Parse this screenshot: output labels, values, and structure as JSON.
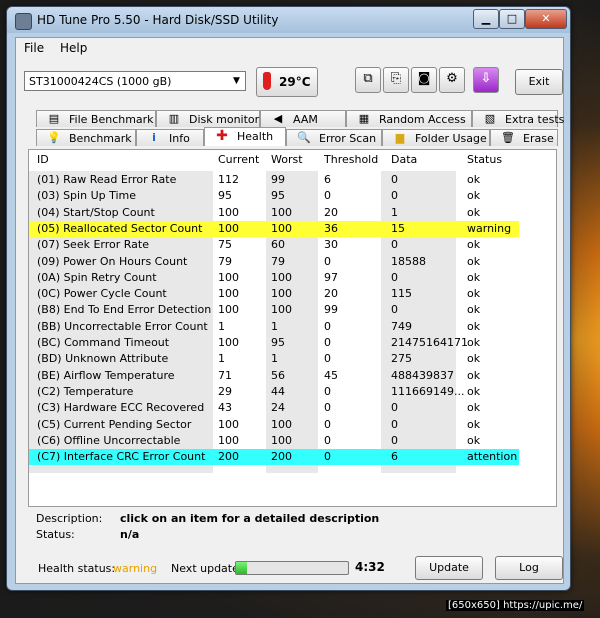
{
  "window": {
    "title": "HD Tune Pro 5.50 - Hard Disk/SSD Utility"
  },
  "window_buttons": {
    "minimize": "▁",
    "maximize": "□",
    "close": "✕"
  },
  "menu": [
    "File",
    "Help"
  ],
  "toolbar": {
    "drive": "ST31000424CS (1000 gB)",
    "temperature": "29°C",
    "exit_label": "Exit"
  },
  "tabs_top": [
    {
      "label": "File Benchmark",
      "icon": "file-benchmark-icon"
    },
    {
      "label": "Disk monitor",
      "icon": "disk-monitor-icon"
    },
    {
      "label": "AAM",
      "icon": "speaker-icon"
    },
    {
      "label": "Random Access",
      "icon": "random-access-icon"
    },
    {
      "label": "Extra tests",
      "icon": "extra-tests-icon"
    }
  ],
  "tabs_bottom": [
    {
      "label": "Benchmark",
      "icon": "benchmark-icon"
    },
    {
      "label": "Info",
      "icon": "info-icon"
    },
    {
      "label": "Health",
      "icon": "health-icon"
    },
    {
      "label": "Error Scan",
      "icon": "error-scan-icon"
    },
    {
      "label": "Folder Usage",
      "icon": "folder-icon"
    },
    {
      "label": "Erase",
      "icon": "erase-icon"
    }
  ],
  "table": {
    "columns": [
      "ID",
      "Current",
      "Worst",
      "Threshold",
      "Data",
      "Status"
    ],
    "rows": [
      {
        "id": "(01) Raw Read Error Rate",
        "current": "112",
        "worst": "99",
        "threshold": "6",
        "data": "0",
        "status": "ok"
      },
      {
        "id": "(03) Spin Up Time",
        "current": "95",
        "worst": "95",
        "threshold": "0",
        "data": "0",
        "status": "ok"
      },
      {
        "id": "(04) Start/Stop Count",
        "current": "100",
        "worst": "100",
        "threshold": "20",
        "data": "1",
        "status": "ok"
      },
      {
        "id": "(05) Reallocated Sector Count",
        "current": "100",
        "worst": "100",
        "threshold": "36",
        "data": "15",
        "status": "warning",
        "highlight": "warning"
      },
      {
        "id": "(07) Seek Error Rate",
        "current": "75",
        "worst": "60",
        "threshold": "30",
        "data": "0",
        "status": "ok"
      },
      {
        "id": "(09) Power On Hours Count",
        "current": "79",
        "worst": "79",
        "threshold": "0",
        "data": "18588",
        "status": "ok"
      },
      {
        "id": "(0A) Spin Retry Count",
        "current": "100",
        "worst": "100",
        "threshold": "97",
        "data": "0",
        "status": "ok"
      },
      {
        "id": "(0C) Power Cycle Count",
        "current": "100",
        "worst": "100",
        "threshold": "20",
        "data": "115",
        "status": "ok"
      },
      {
        "id": "(B8) End To End Error Detection",
        "current": "100",
        "worst": "100",
        "threshold": "99",
        "data": "0",
        "status": "ok"
      },
      {
        "id": "(BB) Uncorrectable Error Count",
        "current": "1",
        "worst": "1",
        "threshold": "0",
        "data": "749",
        "status": "ok"
      },
      {
        "id": "(BC) Command Timeout",
        "current": "100",
        "worst": "95",
        "threshold": "0",
        "data": "21475164171",
        "status": "ok"
      },
      {
        "id": "(BD) Unknown Attribute",
        "current": "1",
        "worst": "1",
        "threshold": "0",
        "data": "275",
        "status": "ok"
      },
      {
        "id": "(BE) Airflow Temperature",
        "current": "71",
        "worst": "56",
        "threshold": "45",
        "data": "488439837",
        "status": "ok"
      },
      {
        "id": "(C2) Temperature",
        "current": "29",
        "worst": "44",
        "threshold": "0",
        "data": "111669149...",
        "status": "ok"
      },
      {
        "id": "(C3) Hardware ECC Recovered",
        "current": "43",
        "worst": "24",
        "threshold": "0",
        "data": "0",
        "status": "ok"
      },
      {
        "id": "(C5) Current Pending Sector",
        "current": "100",
        "worst": "100",
        "threshold": "0",
        "data": "0",
        "status": "ok"
      },
      {
        "id": "(C6) Offline Uncorrectable",
        "current": "100",
        "worst": "100",
        "threshold": "0",
        "data": "0",
        "status": "ok"
      },
      {
        "id": "(C7) Interface CRC Error Count",
        "current": "200",
        "worst": "200",
        "threshold": "0",
        "data": "6",
        "status": "attention",
        "highlight": "attention"
      }
    ]
  },
  "description": {
    "label": "Description:",
    "value": "click on an item for a detailed description",
    "status_label": "Status:",
    "status_value": "n/a"
  },
  "status": {
    "health_label": "Health status:",
    "health_value": "warning",
    "next_update_label": "Next update:",
    "next_update_time": "4:32",
    "progress_fraction": 0.1,
    "update_label": "Update",
    "log_label": "Log"
  },
  "watermark": "[650x650] https://upic.me/",
  "colors": {
    "warning_row": "#ffff33",
    "attention_row": "#33ffff",
    "health_warning_text": "#e6a000"
  }
}
